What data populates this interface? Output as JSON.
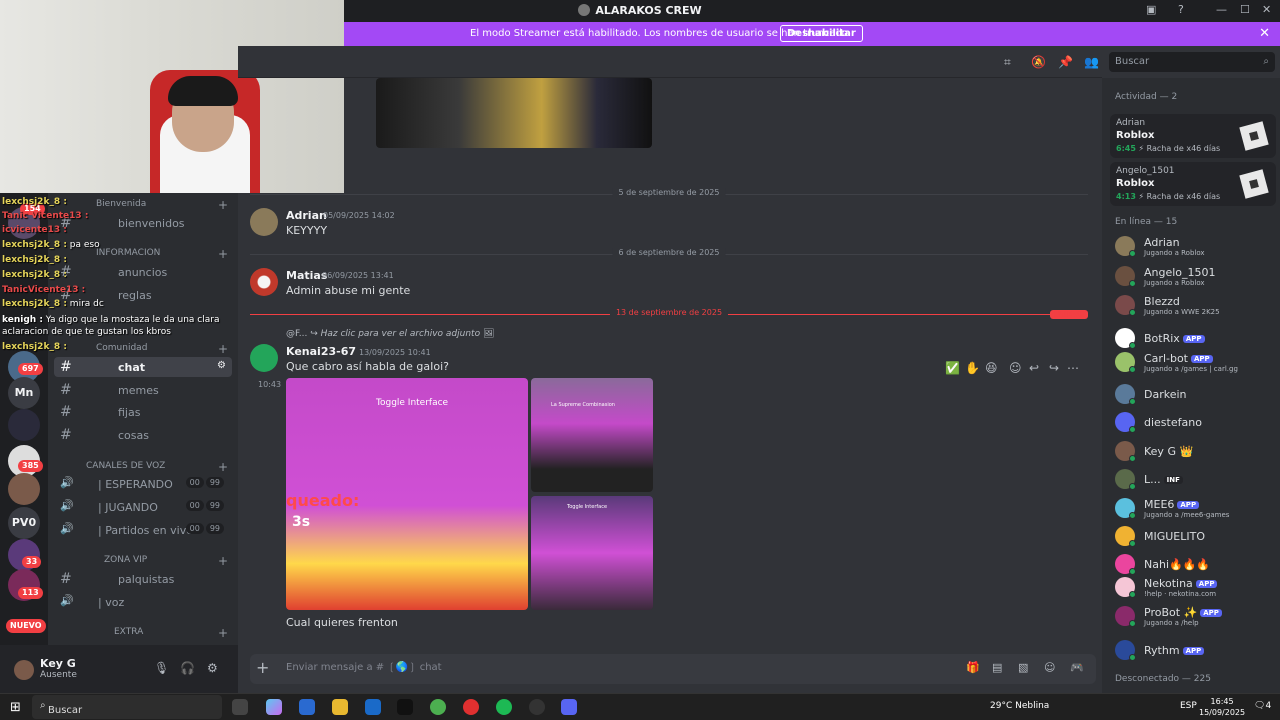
{
  "window": {
    "title": "ALARAKOS CREW"
  },
  "banner": {
    "text": "El modo Streamer está habilitado. Los nombres de usuario se han truncado.",
    "button": "Deshabilitar"
  },
  "search": {
    "placeholder": "Buscar"
  },
  "stream_chat": [
    {
      "name": "lexchsj2k_8 :",
      "text": ""
    },
    {
      "name": "Tanic Vicente13 :",
      "text": ""
    },
    {
      "name": "icvicente13 :",
      "text": ""
    },
    {
      "name": "lexchsj2k_8 :",
      "text": "pa eso"
    },
    {
      "name": "lexchsj2k_8 :",
      "text": ""
    },
    {
      "name": "lexchsj2k_8 :",
      "text": ""
    },
    {
      "name": "TanicVicente13 :",
      "text": ""
    },
    {
      "name": "lexchsj2k_8 :",
      "text": "mira dc"
    },
    {
      "name": "kenigh :",
      "text": "Ya digo que la mostaza le da una clara aclaracion de que te gustan los kbros"
    },
    {
      "name": "lexchsj2k_8 :",
      "text": ""
    }
  ],
  "rail": {
    "badges": [
      "154",
      "697",
      "385",
      "33",
      "113"
    ],
    "labels": [
      "Mn",
      "PV0"
    ],
    "nuevo": "NUEVO"
  },
  "sidebar": {
    "categories": {
      "bienvenida": "Bienvenida",
      "informacion": "INFORMACION",
      "comunidad": "Comunidad",
      "voz": "CANALES DE VOZ",
      "vip": "ZONA VIP",
      "extra": "EXTRA"
    },
    "channels": {
      "bienvenidos": "bienvenidos",
      "anuncios": "anuncios",
      "reglas": "reglas",
      "chat": "chat",
      "memes": "memes",
      "fijas": "fijas",
      "cosas": "cosas",
      "palquistas": "palquistas",
      "voz": "| voz"
    },
    "voice": [
      {
        "label": "| ESPERANDO",
        "a": "00",
        "b": "99"
      },
      {
        "label": "| JUGANDO",
        "a": "00",
        "b": "99"
      },
      {
        "label": "| Partidos en vivo",
        "a": "00",
        "b": "99"
      }
    ]
  },
  "user": {
    "name": "Key G",
    "status": "Ausente"
  },
  "messages": {
    "date1": "5 de septiembre de 2025",
    "date2": "6 de septiembre de 2025",
    "date3": "13 de septiembre de 2025",
    "new_label": "NUEVO",
    "m1": {
      "author": "Adrian",
      "time": "05/09/2025 14:02",
      "text": "KEYYYY"
    },
    "m2": {
      "author": "Matias",
      "time": "06/09/2025 13:41",
      "text": "Admin abuse mi gente"
    },
    "m3": {
      "reply_author": "@F...",
      "reply_text": "Haz clic para ver el archivo adjunto",
      "author": "Kenai23-67",
      "time": "13/09/2025 10:41",
      "side_time": "10:43",
      "text": "Que cabro así habla de gaIoi?",
      "toggle": "Toggle Interface",
      "game_text_1": "queado:",
      "game_text_2": "3s",
      "thumb_1": "La Supreme Combinasion",
      "thumb_2": "Toggle Interface"
    },
    "m4": {
      "text": "Cual quieres frenton"
    }
  },
  "composer": {
    "placeholder": "Enviar mensaje a # ❲🌎❳ chat"
  },
  "members": {
    "activity_header": "Actividad — 2",
    "activities": [
      {
        "user": "Adrian",
        "game": "Roblox",
        "time": "6:45",
        "streak": "Racha de x46 días"
      },
      {
        "user": "Angelo_1501",
        "game": "Roblox",
        "time": "4:13",
        "streak": "Racha de x46 días"
      }
    ],
    "online_header": "En línea — 15",
    "online": [
      {
        "name": "Adrian",
        "status": "Jugando a Roblox",
        "color": "#8a7a5a"
      },
      {
        "name": "Angelo_1501",
        "status": "Jugando a Roblox",
        "color": "#6a5040"
      },
      {
        "name": "Blezzd",
        "status": "Jugando a WWE 2K25",
        "color": "#7a4a4a"
      },
      {
        "name": "BotRix",
        "status": "",
        "app": "APP",
        "color": "#ffffff"
      },
      {
        "name": "Carl-bot",
        "status": "Jugando a /games | carl.gg",
        "app": "APP",
        "color": "#9ac26a"
      },
      {
        "name": "Darkein",
        "status": "",
        "color": "#5a7a9a"
      },
      {
        "name": "diestefano",
        "status": "",
        "color": "#5865f2"
      },
      {
        "name": "Key G 👑",
        "status": "",
        "color": "#7a5a4a"
      },
      {
        "name": "L...",
        "status": "",
        "tag": "INF",
        "color": "#5a6a4a"
      },
      {
        "name": "MEE6",
        "status": "Jugando a /mee6-games",
        "app": "APP",
        "color": "#5bc0de"
      },
      {
        "name": "MIGUELITO",
        "status": "",
        "color": "#f0b232"
      },
      {
        "name": "Nahi🔥🔥🔥",
        "status": "",
        "color": "#eb459e"
      },
      {
        "name": "Nekotina",
        "status": "!help · nekotina.com",
        "app": "APP",
        "color": "#f5c6d6"
      },
      {
        "name": "ProBot ✨",
        "status": "Jugando a /help",
        "app": "APP",
        "color": "#8a2a6a"
      },
      {
        "name": "Rythm",
        "status": "",
        "app": "APP",
        "color": "#2a4a9a"
      }
    ],
    "offline_header": "Desconectado — 225"
  },
  "taskbar": {
    "search": "Buscar",
    "weather": "29°C  Neblina",
    "lang": "ESP",
    "time": "16:45",
    "date": "15/09/2025",
    "notif": "4"
  }
}
